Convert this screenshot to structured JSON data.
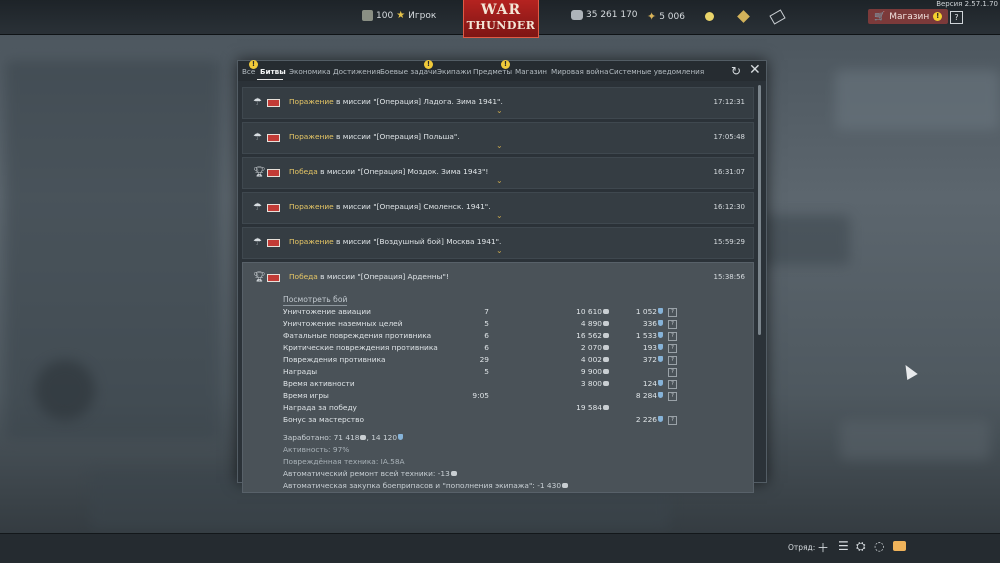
{
  "header": {
    "player_level": "100",
    "player_name": "Игрок",
    "logo_line1": "WAR",
    "logo_line2": "THUNDER",
    "silver_lions": "35 261 170",
    "golden_eagles": "5 006",
    "shop_label": "Магазин",
    "shop_badge": "!",
    "help_label": "?",
    "version": "Версия 2.57.1.70"
  },
  "tabs": [
    {
      "label": "Все",
      "alert": true
    },
    {
      "label": "Битвы",
      "alert": false,
      "active": true
    },
    {
      "label": "Экономика",
      "alert": false
    },
    {
      "label": "Достижения",
      "alert": false
    },
    {
      "label": "Боевые задачи",
      "alert": true
    },
    {
      "label": "Экипажи",
      "alert": false
    },
    {
      "label": "Предметы",
      "alert": true
    },
    {
      "label": "Магазин",
      "alert": false
    },
    {
      "label": "Мировая война",
      "alert": false
    },
    {
      "label": "Системные уведомления",
      "alert": false
    }
  ],
  "alert_glyph": "!",
  "messages": [
    {
      "result": "Поражение",
      "text": " в миссии \"[Операция] Ладога. Зима 1941\".",
      "time": "17:12:31",
      "icon": "parachute-icon"
    },
    {
      "result": "Поражение",
      "text": " в миссии \"[Операция] Польша\".",
      "time": "17:05:48",
      "icon": "parachute-icon"
    },
    {
      "result": "Победа",
      "text": " в миссии \"[Операция] Моздок. Зима 1943\"!",
      "time": "16:31:07",
      "icon": "trophy-icon"
    },
    {
      "result": "Поражение",
      "text": " в миссии \"[Операция] Смоленск. 1941\".",
      "time": "16:12:30",
      "icon": "parachute-icon"
    },
    {
      "result": "Поражение",
      "text": " в миссии \"[Воздушный бой] Москва 1941\".",
      "time": "15:59:29",
      "icon": "parachute-icon"
    }
  ],
  "expanded": {
    "result": "Победа",
    "text": " в миссии \"[Операция] Арденны\"!",
    "time": "15:38:56",
    "review_label": "Посмотреть бой",
    "stats": [
      {
        "name": "Уничтожение авиации",
        "count": "7",
        "silver": "10 610",
        "rp": "1 052",
        "help": "?"
      },
      {
        "name": "Уничтожение наземных целей",
        "count": "5",
        "silver": "4 890",
        "rp": "336",
        "help": "?"
      },
      {
        "name": "Фатальные повреждения противника",
        "count": "6",
        "silver": "16 562",
        "rp": "1 533",
        "help": "?"
      },
      {
        "name": "Критические повреждения противника",
        "count": "6",
        "silver": "2 070",
        "rp": "193",
        "help": "?"
      },
      {
        "name": "Повреждения противника",
        "count": "29",
        "silver": "4 002",
        "rp": "372",
        "help": "?"
      },
      {
        "name": "Награды",
        "count": "5",
        "silver": "9 900",
        "rp": "",
        "help": "?"
      },
      {
        "name": "Время активности",
        "count": "",
        "silver": "3 800",
        "rp": "124",
        "help": "?"
      },
      {
        "name": "Время игры",
        "count": "9:05",
        "silver": "",
        "rp": "8 284",
        "help": "?"
      },
      {
        "name": "Награда за победу",
        "count": "",
        "silver": "19 584",
        "rp": "",
        "help": ""
      },
      {
        "name": "Бонус за мастерство",
        "count": "",
        "silver": "",
        "rp": "2 226",
        "help": "?"
      }
    ],
    "earned_label": "Заработано: ",
    "earned_silver": "71 418",
    "earned_sep": ", ",
    "earned_rp": "14 120",
    "activity": "Активность: 97%",
    "damaged": "Повреждённая техника: IA.58A",
    "auto_repair_label": "Автоматический ремонт всей техники: ",
    "auto_repair_value": "-13",
    "auto_purchase_label": "Автоматическая закупка боеприпасов и \"пополнения экипажа\": ",
    "auto_purchase_value": "-1 430"
  },
  "footer": {
    "squad_label": "Отряд:"
  }
}
